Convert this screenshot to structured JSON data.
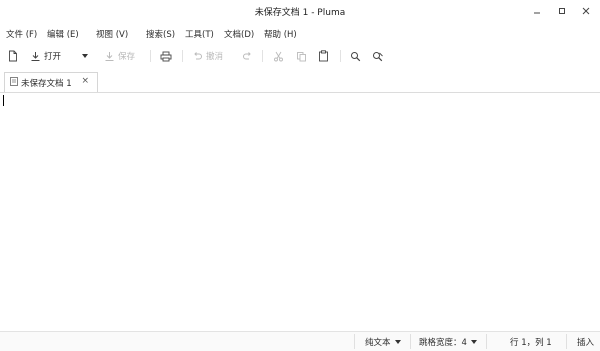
{
  "window": {
    "title": "未保存文档 1 - Pluma",
    "minimize_icon": "minimize-icon",
    "maximize_icon": "maximize-icon",
    "close_icon": "close-icon"
  },
  "menubar": {
    "items": [
      {
        "label": "文件 (F)"
      },
      {
        "label": "编辑 (E)"
      },
      {
        "label": "视图 (V)"
      },
      {
        "label": "搜索(S)"
      },
      {
        "label": "工具(T)"
      },
      {
        "label": "文档(D)"
      },
      {
        "label": "帮助 (H)"
      }
    ]
  },
  "toolbar": {
    "new_icon": "new-document-icon",
    "open_label": "打开",
    "open_icon": "open-icon",
    "open_dropdown_icon": "chevron-down-icon",
    "save_label": "保存",
    "save_icon": "save-icon",
    "print_icon": "print-icon",
    "undo_label": "撤消",
    "undo_icon": "undo-icon",
    "redo_icon": "redo-icon",
    "cut_icon": "cut-icon",
    "copy_icon": "copy-icon",
    "paste_icon": "paste-icon",
    "find_icon": "search-icon",
    "replace_icon": "find-replace-icon"
  },
  "tabs": [
    {
      "label": "未保存文档 1",
      "icon": "document-icon",
      "close_icon": "close-icon"
    }
  ],
  "statusbar": {
    "language": "纯文本",
    "tab_width": "跳格宽度：4",
    "position": "行 1，列 1",
    "mode": "插入"
  }
}
